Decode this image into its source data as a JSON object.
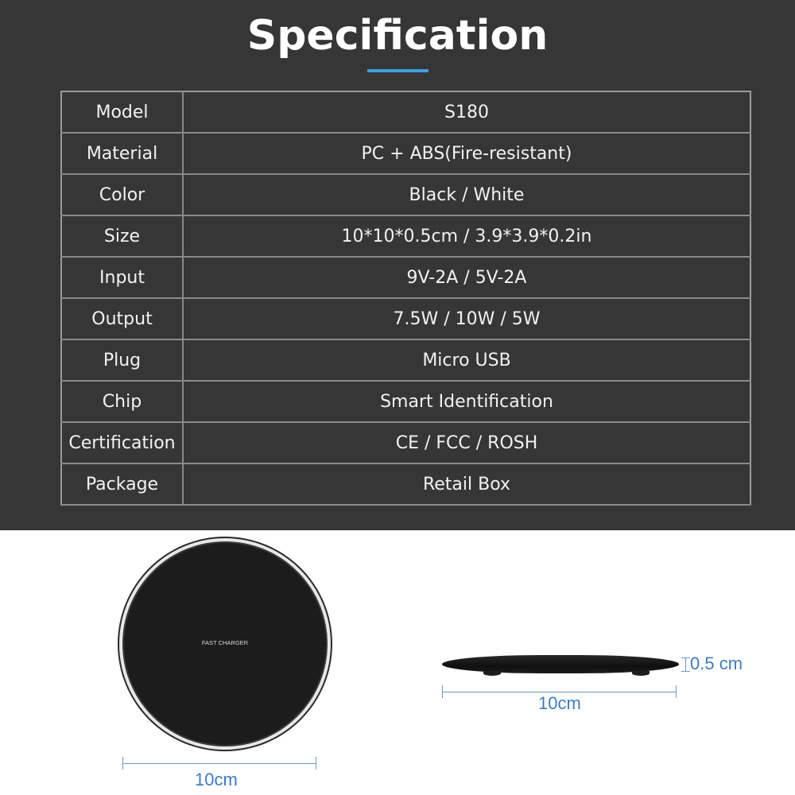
{
  "header": {
    "title": "Specification",
    "accent_color": "#3aa3e0"
  },
  "spec_table": {
    "rows": [
      {
        "label": "Model",
        "value": "S180"
      },
      {
        "label": "Material",
        "value": "PC + ABS(Fire-resistant)"
      },
      {
        "label": "Color",
        "value": "Black / White"
      },
      {
        "label": "Size",
        "value": "10*10*0.5cm / 3.9*3.9*0.2in"
      },
      {
        "label": "Input",
        "value": "9V-2A / 5V-2A"
      },
      {
        "label": "Output",
        "value": "7.5W / 10W / 5W"
      },
      {
        "label": "Plug",
        "value": "Micro USB"
      },
      {
        "label": "Chip",
        "value": "Smart Identification"
      },
      {
        "label": "Certification",
        "value": "CE / FCC / ROSH"
      },
      {
        "label": "Package",
        "value": "Retail Box"
      }
    ]
  },
  "product_images": {
    "top_view": {
      "printed_text": "FAST CHARGER",
      "width_label": "10cm"
    },
    "side_view": {
      "width_label": "10cm",
      "thickness_label": "0.5 cm"
    },
    "dimension_color": "#3a7cc7"
  }
}
